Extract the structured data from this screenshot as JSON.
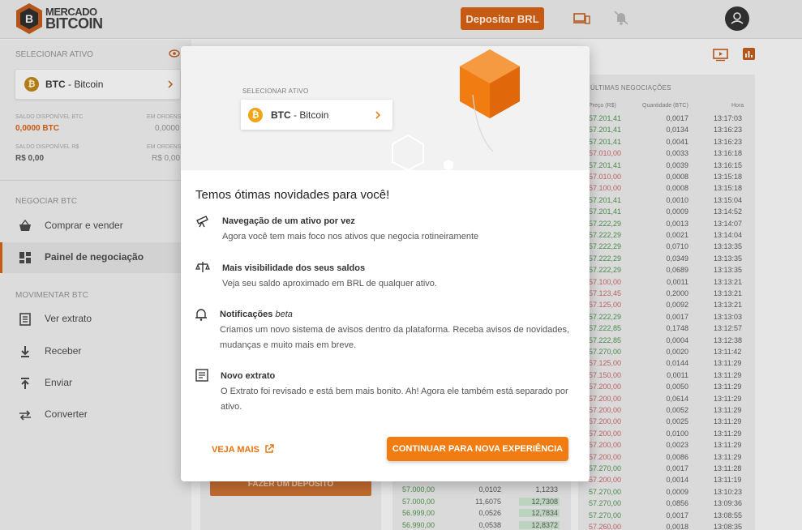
{
  "header": {
    "logo_line1": "MERCADO",
    "logo_line2": "BITCOIN",
    "deposit_label": "Depositar BRL",
    "logo_letter": "B"
  },
  "sidebar": {
    "select_asset_title": "SELECIONAR ATIVO",
    "asset_symbol": "BTC",
    "asset_sep": " - ",
    "asset_name": "Bitcoin",
    "saldo_btc_label": "SALDO DISPONÍVEL BTC",
    "saldo_btc_value": "0,0000 BTC",
    "em_ordens_label": "EM ORDENS",
    "em_ordens_btc": "0,0000",
    "saldo_brl_label": "SALDO DISPONÍVEL R$",
    "saldo_brl_value": "R$ 0,00",
    "em_ordens_brl": "R$ 0,00",
    "negociar_title": "NEGOCIAR BTC",
    "negociar_items": [
      {
        "label": "Comprar e vender"
      },
      {
        "label": "Painel de negociação"
      }
    ],
    "movimentar_title": "MOVIMENTAR BTC",
    "movimentar_items": [
      {
        "label": "Ver extrato"
      },
      {
        "label": "Receber"
      },
      {
        "label": "Enviar"
      },
      {
        "label": "Converter"
      }
    ]
  },
  "trades": {
    "title": "ÚLTIMAS NEGOCIAÇÕES",
    "col_price": "Preço (R$)",
    "col_qty": "Quantidade (BTC)",
    "col_time": "Hora",
    "rows": [
      {
        "price": "57.201,41",
        "qty": "0,0017",
        "time": "13:17:03",
        "side": "green"
      },
      {
        "price": "57.201,41",
        "qty": "0,0134",
        "time": "13:16:23",
        "side": "green"
      },
      {
        "price": "57.201,41",
        "qty": "0,0041",
        "time": "13:16:23",
        "side": "green"
      },
      {
        "price": "57.010,00",
        "qty": "0,0033",
        "time": "13:16:18",
        "side": "red"
      },
      {
        "price": "57.201,41",
        "qty": "0,0039",
        "time": "13:16:15",
        "side": "green"
      },
      {
        "price": "57.010,00",
        "qty": "0,0008",
        "time": "13:15:18",
        "side": "red"
      },
      {
        "price": "57.100,00",
        "qty": "0,0008",
        "time": "13:15:18",
        "side": "red"
      },
      {
        "price": "57.201,41",
        "qty": "0,0010",
        "time": "13:15:04",
        "side": "green"
      },
      {
        "price": "57.201,41",
        "qty": "0,0009",
        "time": "13:14:52",
        "side": "green"
      },
      {
        "price": "57.222,29",
        "qty": "0,0013",
        "time": "13:14:07",
        "side": "green"
      },
      {
        "price": "57.222,29",
        "qty": "0,0021",
        "time": "13:14:04",
        "side": "green"
      },
      {
        "price": "57.222,29",
        "qty": "0,0710",
        "time": "13:13:35",
        "side": "green"
      },
      {
        "price": "57.222,29",
        "qty": "0,0349",
        "time": "13:13:35",
        "side": "green"
      },
      {
        "price": "57.222,29",
        "qty": "0,0689",
        "time": "13:13:35",
        "side": "green"
      },
      {
        "price": "57.100,00",
        "qty": "0,0011",
        "time": "13:13:21",
        "side": "red"
      },
      {
        "price": "57.123,45",
        "qty": "0,2000",
        "time": "13:13:21",
        "side": "red"
      },
      {
        "price": "57.125,00",
        "qty": "0,0092",
        "time": "13:13:21",
        "side": "red"
      },
      {
        "price": "57.222,29",
        "qty": "0,0017",
        "time": "13:13:03",
        "side": "green"
      },
      {
        "price": "57.222,85",
        "qty": "0,1748",
        "time": "13:12:57",
        "side": "green"
      },
      {
        "price": "57.222,85",
        "qty": "0,0004",
        "time": "13:12:38",
        "side": "green"
      },
      {
        "price": "57.270,00",
        "qty": "0,0020",
        "time": "13:11:42",
        "side": "green"
      },
      {
        "price": "57.125,00",
        "qty": "0,0144",
        "time": "13:11:29",
        "side": "red"
      },
      {
        "price": "57.150,00",
        "qty": "0,0011",
        "time": "13:11:29",
        "side": "red"
      },
      {
        "price": "57.200,00",
        "qty": "0,0050",
        "time": "13:11:29",
        "side": "red"
      },
      {
        "price": "57.200,00",
        "qty": "0,0614",
        "time": "13:11:29",
        "side": "red"
      },
      {
        "price": "57.200,00",
        "qty": "0,0052",
        "time": "13:11:29",
        "side": "red"
      },
      {
        "price": "57.200,00",
        "qty": "0,0025",
        "time": "13:11:29",
        "side": "red"
      },
      {
        "price": "57.200,00",
        "qty": "0,0100",
        "time": "13:11:29",
        "side": "red"
      },
      {
        "price": "57.200,00",
        "qty": "0,0023",
        "time": "13:11:29",
        "side": "red"
      },
      {
        "price": "57.200,00",
        "qty": "0,0086",
        "time": "13:11:29",
        "side": "red"
      },
      {
        "price": "57.270,00",
        "qty": "0,0017",
        "time": "13:11:28",
        "side": "green"
      },
      {
        "price": "57.200,00",
        "qty": "0,0014",
        "time": "13:11:19",
        "side": "red"
      },
      {
        "price": "57.270,00",
        "qty": "0,0009",
        "time": "13:10:23",
        "side": "green"
      },
      {
        "price": "57.270,00",
        "qty": "0,0856",
        "time": "13:09:36",
        "side": "green"
      },
      {
        "price": "57.270,00",
        "qty": "0,0017",
        "time": "13:08:55",
        "side": "green"
      },
      {
        "price": "57.260,00",
        "qty": "0,0018",
        "time": "13:08:35",
        "side": "red"
      }
    ]
  },
  "orderbook": {
    "rows": [
      {
        "price": "57.000,00",
        "qty": "0,0102",
        "total": "1,1233"
      },
      {
        "price": "57.000,00",
        "qty": "11,6075",
        "total": "12,7308"
      },
      {
        "price": "56.999,00",
        "qty": "0,0526",
        "total": "12,7834"
      },
      {
        "price": "56.990,00",
        "qty": "0,0538",
        "total": "12,8372"
      }
    ]
  },
  "fazer_deposito": "FAZER UM DEPÓSITO",
  "modal": {
    "preview_label": "SELECIONAR ATIVO",
    "preview_symbol": "BTC",
    "preview_sep": " - ",
    "preview_name": "Bitcoin",
    "title": "Temos ótimas novidades para você!",
    "features": [
      {
        "title": "Navegação de um ativo por vez",
        "desc": "Agora você tem mais foco nos ativos que negocia rotineiramente"
      },
      {
        "title": "Mais visibilidade dos seus saldos",
        "desc": "Veja seu saldo aproximado em BRL de qualquer ativo."
      },
      {
        "title": "Notificações ",
        "title_suffix": "beta",
        "desc": "Criamos um novo sistema de avisos dentro da plataforma. Receba avisos de novidades, mudanças e muito mais em breve."
      },
      {
        "title": "Novo extrato",
        "desc": "O Extrato foi revisado e está bem mais bonito. Ah! Agora ele também está separado por ativo."
      }
    ],
    "veja_mais": "VEJA MAIS",
    "continuar": "CONTINUAR PARA NOVA EXPERIÊNCIA"
  },
  "colors": {
    "brand_orange": "#f07c12",
    "dark_orange": "#c75a12",
    "buy_green": "#4a8a4a",
    "sell_red": "#b86060"
  }
}
